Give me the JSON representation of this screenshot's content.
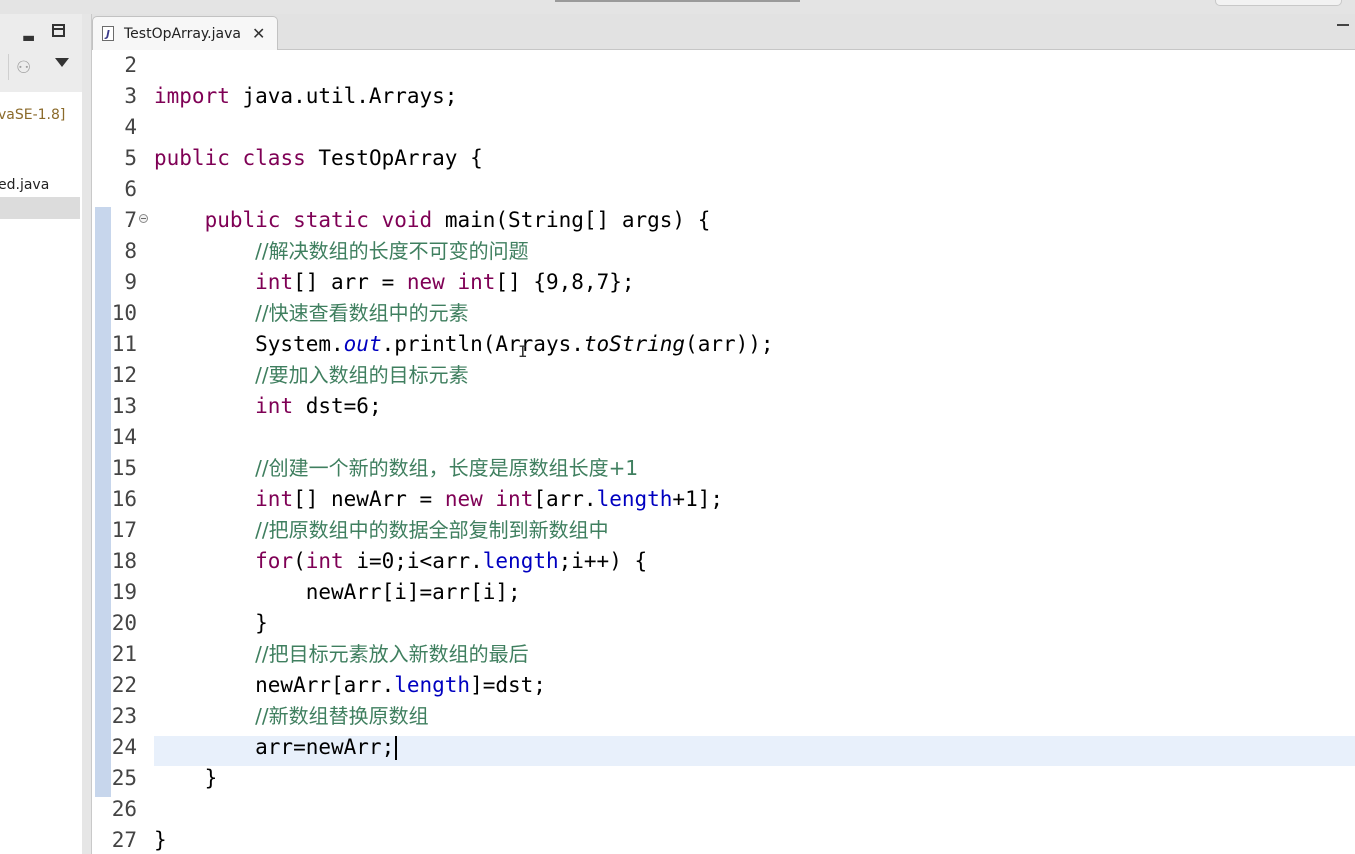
{
  "left_panel": {
    "jre_label": "vaSE-1.8]",
    "file_label": "ed.java"
  },
  "editor_tab": {
    "filename": "TestOpArray.java",
    "icon_letter": "J",
    "close_glyph": "✕"
  },
  "code_lines": [
    {
      "n": "2",
      "segs": []
    },
    {
      "n": "3",
      "segs": [
        {
          "t": "import",
          "c": "kw"
        },
        {
          "t": " java.util.Arrays;",
          "c": ""
        }
      ]
    },
    {
      "n": "4",
      "segs": []
    },
    {
      "n": "5",
      "segs": [
        {
          "t": "public",
          "c": "kw"
        },
        {
          "t": " ",
          "c": ""
        },
        {
          "t": "class",
          "c": "kw"
        },
        {
          "t": " TestOpArray {",
          "c": ""
        }
      ]
    },
    {
      "n": "6",
      "segs": []
    },
    {
      "n": "7",
      "fold": true,
      "segs": [
        {
          "t": "    ",
          "c": ""
        },
        {
          "t": "public",
          "c": "kw"
        },
        {
          "t": " ",
          "c": ""
        },
        {
          "t": "static",
          "c": "kw"
        },
        {
          "t": " ",
          "c": ""
        },
        {
          "t": "void",
          "c": "kw"
        },
        {
          "t": " main(String[] args) {",
          "c": ""
        }
      ]
    },
    {
      "n": "8",
      "segs": [
        {
          "t": "        ",
          "c": ""
        },
        {
          "t": "//解决数组的长度不可变的问题",
          "c": "cm"
        }
      ]
    },
    {
      "n": "9",
      "segs": [
        {
          "t": "        ",
          "c": ""
        },
        {
          "t": "int",
          "c": "kw"
        },
        {
          "t": "[] arr = ",
          "c": ""
        },
        {
          "t": "new",
          "c": "kw"
        },
        {
          "t": " ",
          "c": ""
        },
        {
          "t": "int",
          "c": "kw"
        },
        {
          "t": "[] {9,8,7};",
          "c": ""
        }
      ]
    },
    {
      "n": "10",
      "segs": [
        {
          "t": "        ",
          "c": ""
        },
        {
          "t": "//快速查看数组中的元素",
          "c": "cm"
        }
      ]
    },
    {
      "n": "11",
      "segs": [
        {
          "t": "        System.",
          "c": ""
        },
        {
          "t": "out",
          "c": "sfld"
        },
        {
          "t": ".println(Arrays.",
          "c": ""
        },
        {
          "t": "toString",
          "c": "it"
        },
        {
          "t": "(arr));",
          "c": ""
        }
      ]
    },
    {
      "n": "12",
      "segs": [
        {
          "t": "        ",
          "c": ""
        },
        {
          "t": "//要加入数组的目标元素",
          "c": "cm"
        }
      ]
    },
    {
      "n": "13",
      "segs": [
        {
          "t": "        ",
          "c": ""
        },
        {
          "t": "int",
          "c": "kw"
        },
        {
          "t": " dst=6;",
          "c": ""
        }
      ]
    },
    {
      "n": "14",
      "segs": []
    },
    {
      "n": "15",
      "segs": [
        {
          "t": "        ",
          "c": ""
        },
        {
          "t": "//创建一个新的数组，长度是原数组长度+1",
          "c": "cm"
        }
      ]
    },
    {
      "n": "16",
      "segs": [
        {
          "t": "        ",
          "c": ""
        },
        {
          "t": "int",
          "c": "kw"
        },
        {
          "t": "[] newArr = ",
          "c": ""
        },
        {
          "t": "new",
          "c": "kw"
        },
        {
          "t": " ",
          "c": ""
        },
        {
          "t": "int",
          "c": "kw"
        },
        {
          "t": "[arr.",
          "c": ""
        },
        {
          "t": "length",
          "c": "fld"
        },
        {
          "t": "+1];",
          "c": ""
        }
      ]
    },
    {
      "n": "17",
      "segs": [
        {
          "t": "        ",
          "c": ""
        },
        {
          "t": "//把原数组中的数据全部复制到新数组中",
          "c": "cm"
        }
      ]
    },
    {
      "n": "18",
      "segs": [
        {
          "t": "        ",
          "c": ""
        },
        {
          "t": "for",
          "c": "kw"
        },
        {
          "t": "(",
          "c": ""
        },
        {
          "t": "int",
          "c": "kw"
        },
        {
          "t": " i=0;i<arr.",
          "c": ""
        },
        {
          "t": "length",
          "c": "fld"
        },
        {
          "t": ";i++) {",
          "c": ""
        }
      ]
    },
    {
      "n": "19",
      "segs": [
        {
          "t": "            newArr[i]=arr[i];",
          "c": ""
        }
      ]
    },
    {
      "n": "20",
      "segs": [
        {
          "t": "        }",
          "c": ""
        }
      ]
    },
    {
      "n": "21",
      "segs": [
        {
          "t": "        ",
          "c": ""
        },
        {
          "t": "//把目标元素放入新数组的最后",
          "c": "cm"
        }
      ]
    },
    {
      "n": "22",
      "segs": [
        {
          "t": "        newArr[arr.",
          "c": ""
        },
        {
          "t": "length",
          "c": "fld"
        },
        {
          "t": "]=dst;",
          "c": ""
        }
      ]
    },
    {
      "n": "23",
      "segs": [
        {
          "t": "        ",
          "c": ""
        },
        {
          "t": "//新数组替换原数组",
          "c": "cm"
        }
      ]
    },
    {
      "n": "24",
      "caret": true,
      "segs": [
        {
          "t": "        arr=newArr;",
          "c": ""
        }
      ]
    },
    {
      "n": "25",
      "segs": [
        {
          "t": "    }",
          "c": ""
        }
      ]
    },
    {
      "n": "26",
      "segs": []
    },
    {
      "n": "27",
      "segs": [
        {
          "t": "}",
          "c": ""
        }
      ]
    }
  ],
  "colors": {
    "keyword": "#7f0055",
    "comment": "#3f7f5f",
    "field": "#0000c0",
    "current_line": "#e8f0fb",
    "gutter_marker": "#c7d6ec"
  }
}
